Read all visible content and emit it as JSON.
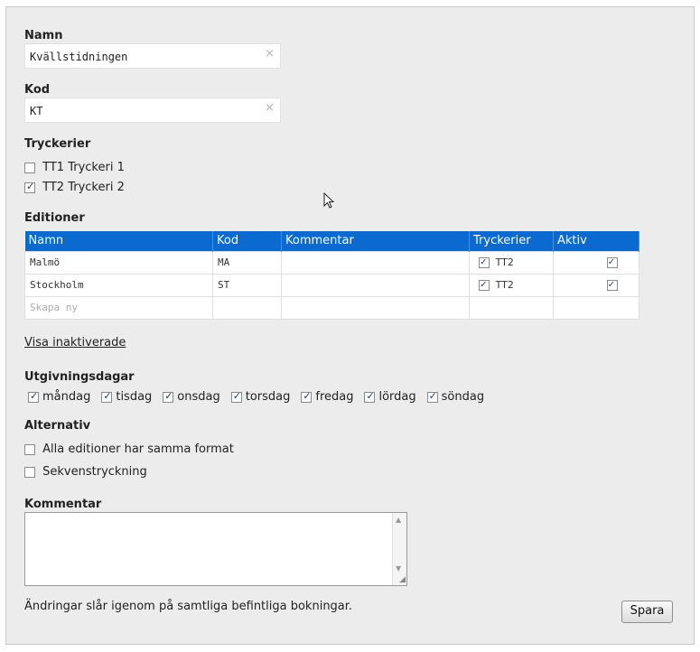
{
  "form": {
    "name_label": "Namn",
    "name_value": "Kvällstidningen",
    "code_label": "Kod",
    "code_value": "KT",
    "clear_symbol": "×",
    "printers_label": "Tryckerier",
    "printers": [
      {
        "label": "TT1 Tryckeri 1",
        "checked": false
      },
      {
        "label": "TT2 Tryckeri 2",
        "checked": true
      }
    ],
    "editions_label": "Editioner",
    "editions_table": {
      "headers": [
        "Namn",
        "Kod",
        "Kommentar",
        "Tryckerier",
        "Aktiv"
      ],
      "rows": [
        {
          "name": "Malmö",
          "code": "MA",
          "comment": "",
          "printer": "TT2",
          "printer_checked": true,
          "active": true
        },
        {
          "name": "Stockholm",
          "code": "ST",
          "comment": "",
          "printer": "TT2",
          "printer_checked": true,
          "active": true
        }
      ],
      "new_row_placeholder": "Skapa ny"
    },
    "show_inactive_link": "Visa inaktiverade",
    "days_label": "Utgivningsdagar",
    "days": [
      {
        "label": "måndag",
        "checked": true
      },
      {
        "label": "tisdag",
        "checked": true
      },
      {
        "label": "onsdag",
        "checked": true
      },
      {
        "label": "torsdag",
        "checked": true
      },
      {
        "label": "fredag",
        "checked": true
      },
      {
        "label": "lördag",
        "checked": true
      },
      {
        "label": "söndag",
        "checked": true
      }
    ],
    "alternatives_label": "Alternativ",
    "alternatives": [
      {
        "label": "Alla editioner har samma format",
        "checked": false
      },
      {
        "label": "Sekvenstryckning",
        "checked": false
      }
    ],
    "comment_label": "Kommentar",
    "comment_value": "",
    "footer_note": "Ändringar slår igenom på samtliga befintliga bokningar.",
    "save_label": "Spara"
  }
}
